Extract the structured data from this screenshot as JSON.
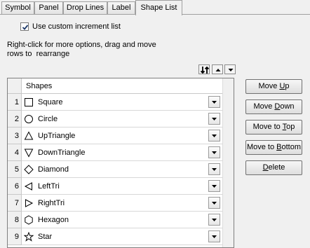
{
  "tabs": [
    {
      "label": "Symbol"
    },
    {
      "label": "Panel"
    },
    {
      "label": "Drop Lines"
    },
    {
      "label": "Label"
    },
    {
      "label": "Shape List",
      "active": true
    }
  ],
  "use_custom": {
    "label": "Use custom increment list",
    "checked": true
  },
  "help_text": "Right-click for more options, drag and move\nrows to  rearrange",
  "grid": {
    "column_header": "Shapes",
    "rows": [
      {
        "num": "1",
        "shape": "Square",
        "icon": "square-icon"
      },
      {
        "num": "2",
        "shape": "Circle",
        "icon": "circle-icon"
      },
      {
        "num": "3",
        "shape": "UpTriangle",
        "icon": "up-triangle-icon"
      },
      {
        "num": "4",
        "shape": "DownTriangle",
        "icon": "down-triangle-icon"
      },
      {
        "num": "5",
        "shape": "Diamond",
        "icon": "diamond-icon"
      },
      {
        "num": "6",
        "shape": "LeftTri",
        "icon": "left-triangle-icon"
      },
      {
        "num": "7",
        "shape": "RightTri",
        "icon": "right-triangle-icon"
      },
      {
        "num": "8",
        "shape": "Hexagon",
        "icon": "hexagon-icon"
      },
      {
        "num": "9",
        "shape": "Star",
        "icon": "star-icon"
      }
    ]
  },
  "side_buttons": {
    "move_up": {
      "pre": "Move ",
      "u": "U",
      "post": "p"
    },
    "move_down": {
      "pre": "Move ",
      "u": "D",
      "post": "own"
    },
    "move_top": {
      "pre": "Move to ",
      "u": "T",
      "post": "op"
    },
    "move_bottom": {
      "pre": "Move to ",
      "u": "B",
      "post": "ottom"
    },
    "delete": {
      "pre": "",
      "u": "D",
      "post": "elete"
    }
  }
}
